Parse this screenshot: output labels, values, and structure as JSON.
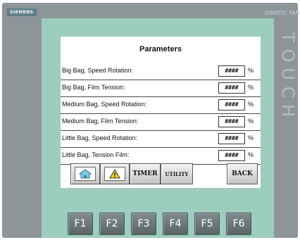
{
  "device": {
    "brand": "SIEMENS",
    "model": "SIMATIC PAN",
    "touch_letters": [
      "T",
      "O",
      "U",
      "C",
      "H"
    ]
  },
  "screen": {
    "title": "Parameters",
    "unit": "%",
    "rows": [
      {
        "label": "Big Bag, Speed Rotation:",
        "value": "####"
      },
      {
        "label": "Big Bag, Film Tension:",
        "value": "####"
      },
      {
        "label": "Medium Bag, Speed Rotation:",
        "value": "####"
      },
      {
        "label": "Medium Bag, Film Tension:",
        "value": "####"
      },
      {
        "label": "Little Bag, Speed Rotation:",
        "value": "####"
      },
      {
        "label": "Little Bag, Tension Film:",
        "value": "####"
      }
    ],
    "buttons": {
      "home_icon": "home-icon",
      "alarm_icon": "warning-icon",
      "timer": "TIMER",
      "utility": "UTILITY",
      "back": "BACK"
    }
  },
  "function_keys": [
    "F1",
    "F2",
    "F3",
    "F4",
    "F5",
    "F6"
  ],
  "colors": {
    "bezel": "#9ccdbd",
    "panel": "#8d9599",
    "brand_badge": "#5e7f85",
    "warning": "#f2d21b"
  }
}
